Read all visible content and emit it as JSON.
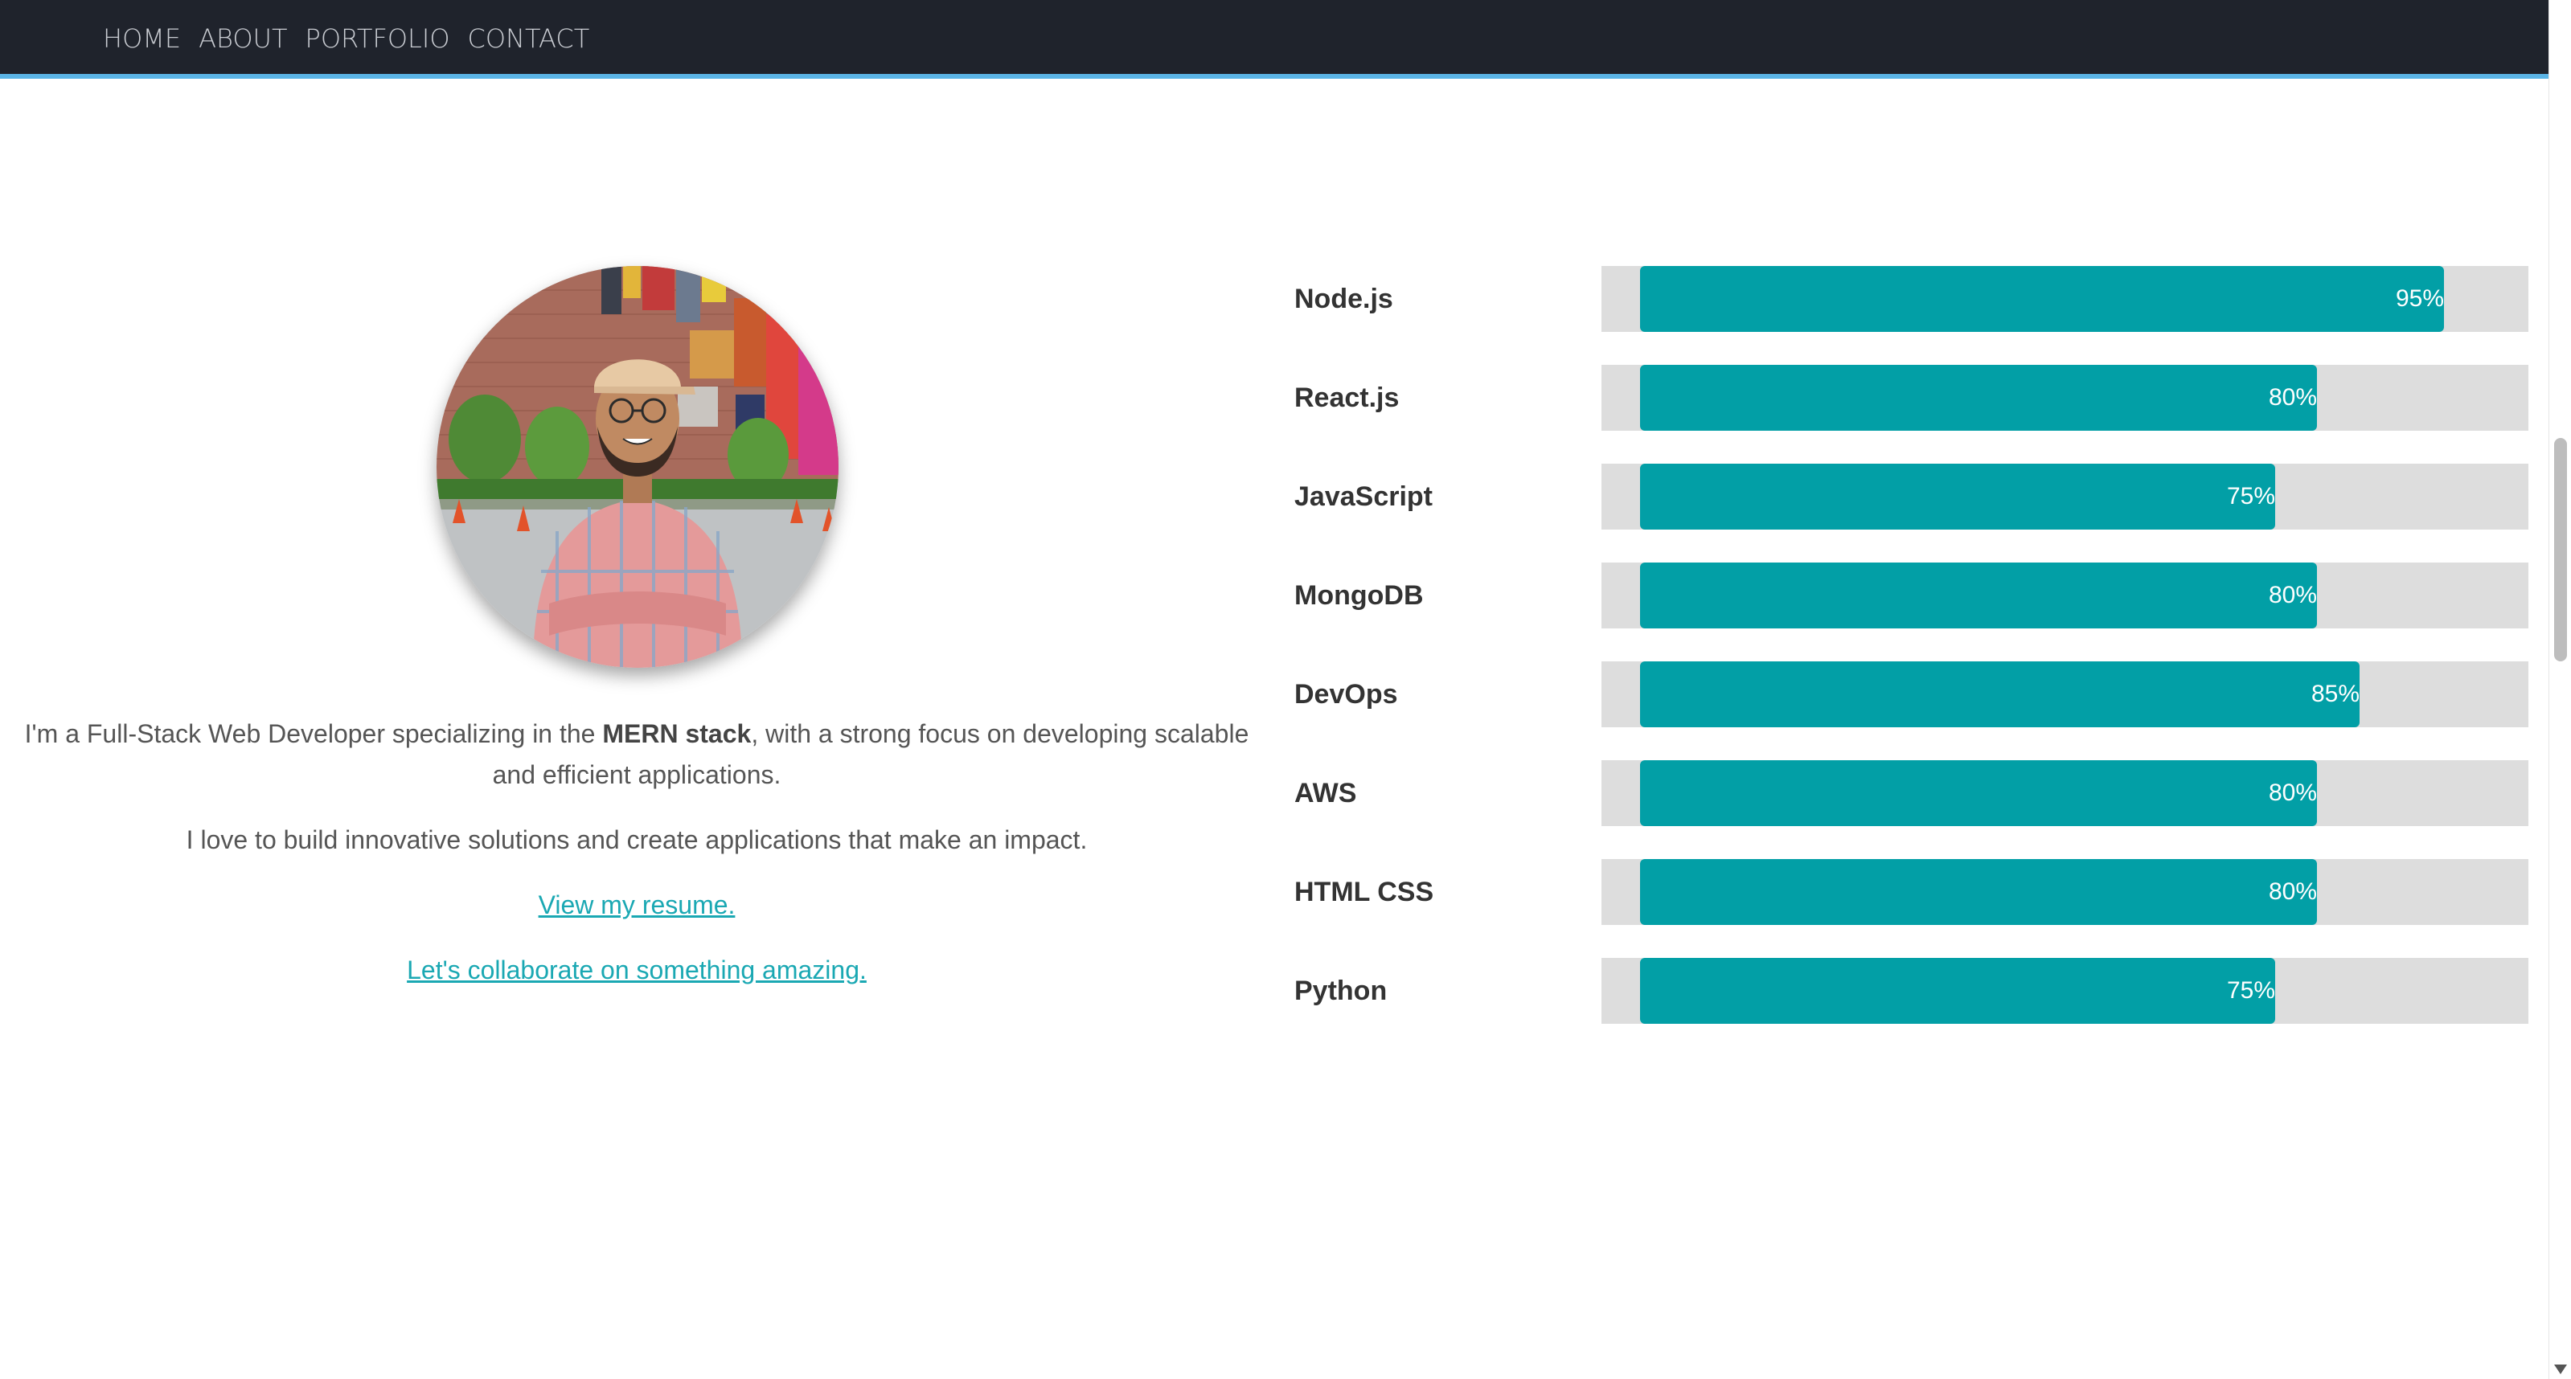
{
  "nav": {
    "items": [
      "HOME",
      "ABOUT",
      "PORTFOLIO",
      "CONTACT"
    ]
  },
  "colors": {
    "header_bg": "#1f232c",
    "header_accent": "#5ab4e6",
    "bar_fill": "#029fa6",
    "bar_track": "#dddddd",
    "link": "#1aa8b3"
  },
  "about": {
    "intro_before": "I'm a Full-Stack Web Developer specializing in the ",
    "intro_bold": "MERN stack",
    "intro_after": ", with a strong focus on developing scalable and efficient applications.",
    "line2": "I love to build innovative solutions and create applications that make an impact.",
    "resume_link": "View my resume.",
    "collab_link": "Let's collaborate on something amazing."
  },
  "skills": [
    {
      "name": "Node.js",
      "percent": 95,
      "label": "95%"
    },
    {
      "name": "React.js",
      "percent": 80,
      "label": "80%"
    },
    {
      "name": "JavaScript",
      "percent": 75,
      "label": "75%"
    },
    {
      "name": "MongoDB",
      "percent": 80,
      "label": "80%"
    },
    {
      "name": "DevOps",
      "percent": 85,
      "label": "85%"
    },
    {
      "name": "AWS",
      "percent": 80,
      "label": "80%"
    },
    {
      "name": "HTML CSS",
      "percent": 80,
      "label": "80%"
    },
    {
      "name": "Python",
      "percent": 75,
      "label": "75%"
    }
  ]
}
